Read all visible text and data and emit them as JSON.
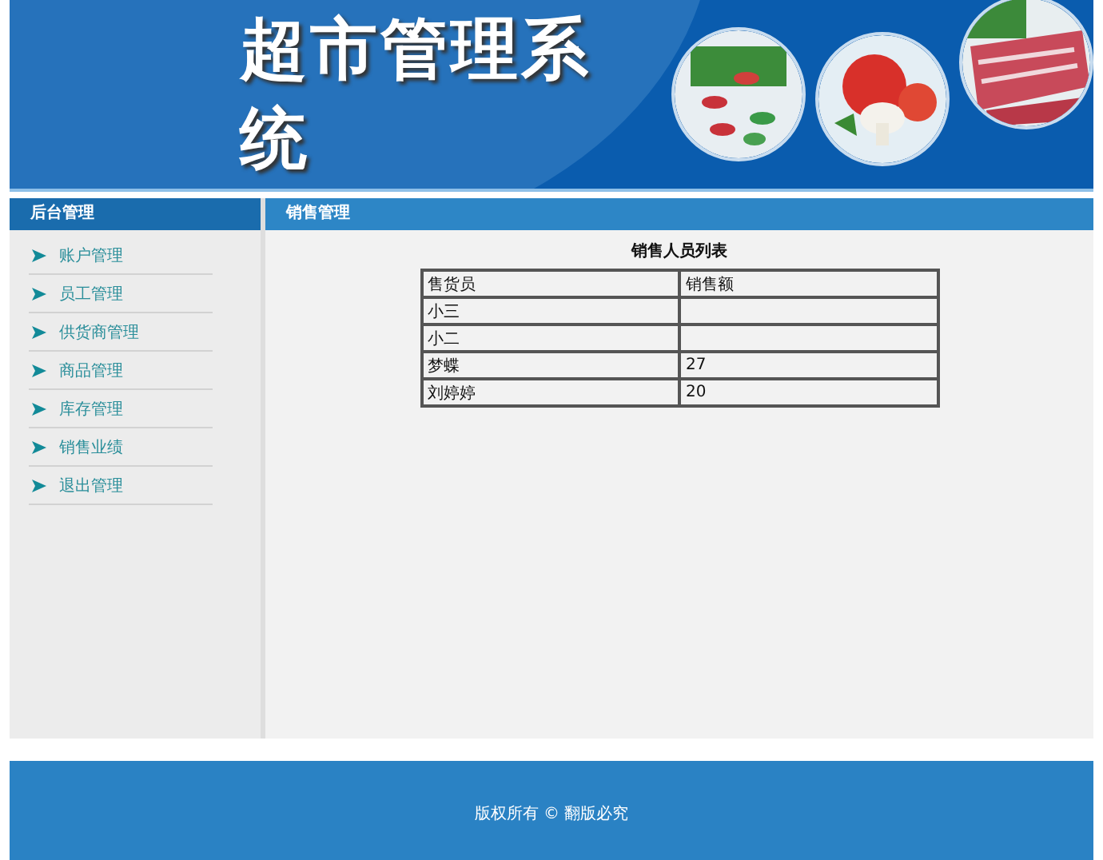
{
  "header": {
    "title": "超市管理系统"
  },
  "sidebar": {
    "heading": "后台管理",
    "items": [
      {
        "label": "账户管理"
      },
      {
        "label": "员工管理"
      },
      {
        "label": "供货商管理"
      },
      {
        "label": "商品管理"
      },
      {
        "label": "库存管理"
      },
      {
        "label": "销售业绩"
      },
      {
        "label": "退出管理"
      }
    ]
  },
  "main": {
    "heading": "销售管理",
    "table": {
      "title": "销售人员列表",
      "columns": [
        "售货员",
        "销售额"
      ],
      "rows": [
        [
          "小三",
          ""
        ],
        [
          "小二",
          ""
        ],
        [
          "梦蝶",
          "27"
        ],
        [
          "刘婷婷",
          "20"
        ]
      ]
    }
  },
  "footer": {
    "text": "版权所有 © 翻版必究"
  }
}
